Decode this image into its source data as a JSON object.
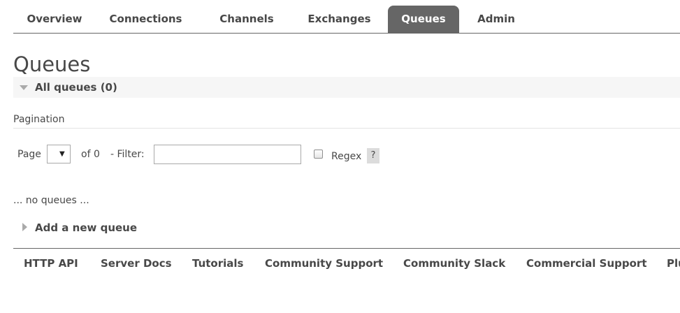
{
  "nav": {
    "tabs": [
      {
        "label": "Overview",
        "active": false
      },
      {
        "label": "Connections",
        "active": false
      },
      {
        "label": "Channels",
        "active": false
      },
      {
        "label": "Exchanges",
        "active": false
      },
      {
        "label": "Queues",
        "active": true
      },
      {
        "label": "Admin",
        "active": false
      }
    ]
  },
  "page": {
    "title": "Queues"
  },
  "all_queues": {
    "label": "All queues (0)",
    "expanded": true
  },
  "pagination": {
    "heading": "Pagination",
    "page_label": "Page",
    "page_value": "",
    "caret": "▼",
    "of_label": "of 0",
    "filter_label": "- Filter:",
    "filter_value": "",
    "regex_label": "Regex",
    "regex_checked": false,
    "help_label": "?"
  },
  "empty_message": "... no queues ...",
  "add_queue": {
    "label": "Add a new queue",
    "expanded": false
  },
  "footer": {
    "links": [
      "HTTP API",
      "Server Docs",
      "Tutorials",
      "Community Support",
      "Community Slack",
      "Commercial Support",
      "Plugins"
    ]
  },
  "colors": {
    "active_tab_bg": "#666666",
    "text": "#484848",
    "section_bg": "#f6f6f6",
    "help_bg": "#dcdcdc"
  }
}
